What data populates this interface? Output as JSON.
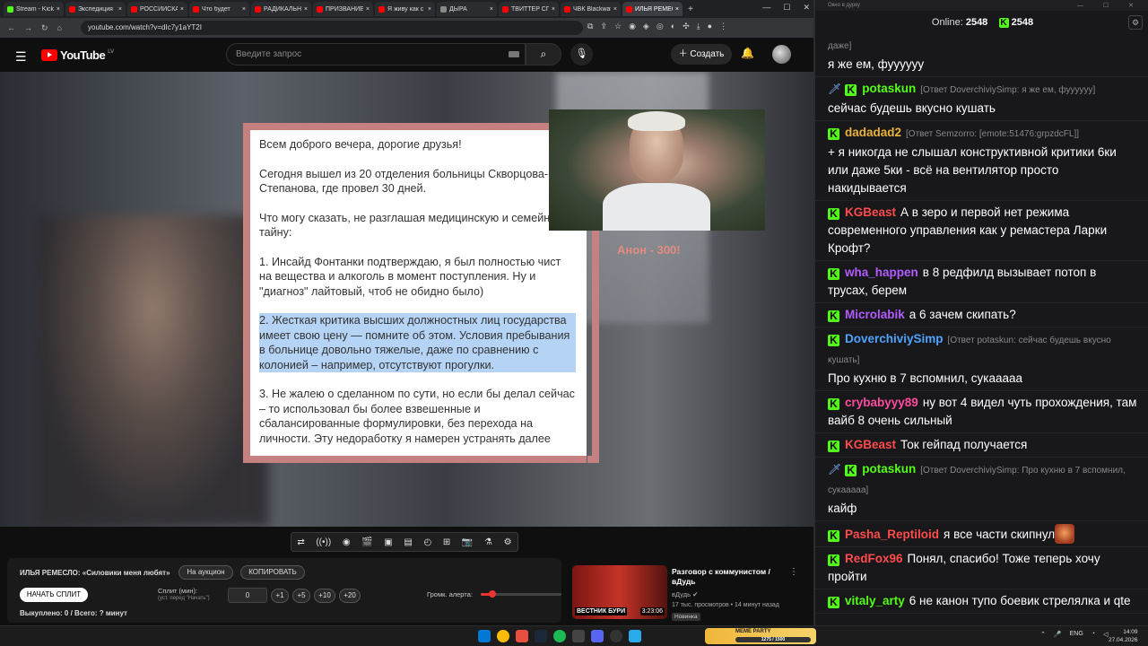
{
  "browser": {
    "tabs": [
      {
        "label": "Stream - Kick",
        "color": "#53fc18"
      },
      {
        "label": "Экспедиция",
        "color": "#ff0000"
      },
      {
        "label": "РОССИЙСКАЯ",
        "color": "#ff0000"
      },
      {
        "label": "Что будет",
        "color": "#ff0000"
      },
      {
        "label": "РАДИКАЛЬНЫЙ",
        "color": "#ff0000"
      },
      {
        "label": "ПРИЗВАНИЕ",
        "color": "#ff0000"
      },
      {
        "label": "Я живу как с",
        "color": "#ff0000"
      },
      {
        "label": "ДЫРА",
        "color": "#888888"
      },
      {
        "label": "ТВИТТЕР СПО",
        "color": "#ff0000"
      },
      {
        "label": "ЧВК Blackwat",
        "color": "#ff0000"
      },
      {
        "label": "ИЛЬЯ РЕМЕСЛО",
        "color": "#ff0000"
      }
    ],
    "new_tab": "+",
    "url": "youtube.com/watch?v=dIc7y1aYT2I"
  },
  "youtube": {
    "logo_text": "YouTube",
    "country": "LV",
    "search_placeholder": "Введите запрос",
    "create_label": "Создать"
  },
  "video": {
    "doc_paragraphs": [
      "Всем доброго вечера, дорогие друзья!",
      "Сегодня вышел из 20 отделения больницы Скворцова-Степанова, где провел 30 дней.",
      "Что могу сказать, не разглашая медицинскую и семейную тайну:",
      "1. Инсайд Фонтанки подтверждаю, я был полностью чист на вещества и алкоголь в момент поступления. Ну и \"диагноз\" лайтовый, чтоб не обидно было)",
      "2. Жесткая критика высших должностных лиц государства имеет свою цену — помните об этом. Условия пребывания в больнице довольно тяжелые, даже по сравнению с колонией – например, отсутствуют прогулки.",
      "3. Не жалею о сделанном по сути, но если бы делал сейчас – то использовал бы более взвешенные и сбалансированные формулировки, без перехода на личности. Эту недоработку я намерен устранять далее"
    ],
    "highlight_index": 4,
    "highlight_color": "#b5d3f5",
    "frame_color": "#c5817f",
    "overlay_text": "Анон - 300!"
  },
  "toolbar_icons": [
    "loop-icon",
    "broadcast-icon",
    "eye-icon",
    "clapperboard-icon",
    "picture-in-picture-icon",
    "film-icon",
    "speedometer-icon",
    "image-add-icon",
    "camera-icon",
    "flask-icon",
    "gear-icon"
  ],
  "auction": {
    "title": "ИЛЬЯ РЕМЕСЛО: «Силовики меня любят»",
    "on_auction": "На аукцион",
    "copy": "КОПИРОВАТЬ",
    "start_split": "НАЧАТЬ СПЛИТ",
    "split_label": "Сплит (мин):",
    "split_sub": "(уст. перед \"Начать\")",
    "split_value": "0",
    "increments": [
      "+1",
      "+5",
      "+10",
      "+20"
    ],
    "volume_label": "Громк. алерта:",
    "volume_level": 0.12,
    "bought": "Выкуплено: 0 / Всего: ? минут"
  },
  "recommendation": {
    "thumb_caption": "ВЕСТНИК БУРИ",
    "duration": "3:23:06",
    "title": "Разговор с коммунистом / вДудь",
    "channel": "вДудь",
    "meta": "17 тыс. просмотров • 14 минут назад",
    "badge": "Новинка"
  },
  "chat": {
    "window_title": "Окно в дурку",
    "online_label": "Online:",
    "online_count": "2548",
    "kick_count": "2548",
    "messages": [
      {
        "nick": "",
        "color": "#ffffff",
        "reply": "даже]",
        "text": "я же ем, фуууууу",
        "badge": false,
        "sword": false
      },
      {
        "nick": "potaskun",
        "color": "#53fc18",
        "reply": "[Ответ DoverchiviySimp: я же ем, фуууууу]",
        "text": "сейчас будешь вкусно кушать",
        "badge": true,
        "sword": true
      },
      {
        "nick": "dadadad2",
        "color": "#e9b23a",
        "reply": "[Ответ Semzorro: [emote:51476:grpzdcFL]]",
        "text": "+ я никогда не слышал конструктивной критики 6ки или даже 5ки - всё на вентилятор просто накидывается",
        "badge": true,
        "sword": false
      },
      {
        "nick": "KGBeast",
        "color": "#ff4b4b",
        "reply": "",
        "text": "А в зеро и первой нет режима современного управления как у ремастера Ларки Крофт?",
        "badge": true,
        "sword": false
      },
      {
        "nick": "wha_happen",
        "color": "#b05cff",
        "reply": "",
        "text": "в 8 редфилд вызывает потоп в трусах, берем",
        "badge": true,
        "sword": false
      },
      {
        "nick": "Microlabik",
        "color": "#b05cff",
        "reply": "",
        "text": "а 6 зачем скипать?",
        "badge": true,
        "sword": false
      },
      {
        "nick": "DoverchiviySimp",
        "color": "#4fa3ff",
        "reply": "[Ответ potaskun: сейчас будешь вкусно кушать]",
        "text": "Про кухню в 7 вспомнил, сукааааа",
        "badge": true,
        "sword": false
      },
      {
        "nick": "crybabyyy89",
        "color": "#ff4b9e",
        "reply": "",
        "text": "ну вот 4 видел чуть прохождения, там вайб 8 очень сильный",
        "badge": true,
        "sword": false
      },
      {
        "nick": "KGBeast",
        "color": "#ff4b4b",
        "reply": "",
        "text": "Ток гейпад получается",
        "badge": true,
        "sword": false
      },
      {
        "nick": "potaskun",
        "color": "#53fc18",
        "reply": "[Ответ DoverchiviySimp: Про кухню в 7 вспомнил, сукааааа]",
        "text": "кайф",
        "badge": true,
        "sword": true
      },
      {
        "nick": "Pasha_Reptiloid",
        "color": "#ff4b4b",
        "reply": "",
        "text": "я все части скипнул",
        "badge": true,
        "sword": false,
        "emote": true
      },
      {
        "nick": "RedFox96",
        "color": "#ff4b4b",
        "reply": "",
        "text": "Понял, спасибо! Тоже теперь хочу пройти",
        "badge": true,
        "sword": false
      },
      {
        "nick": "vitaly_arty",
        "color": "#53fc18",
        "reply": "",
        "text": "6 не канон тупо боевик стрелялка и qte",
        "badge": true,
        "sword": false
      }
    ]
  },
  "taskbar": {
    "meme_label": "MEME PARTY",
    "meme_progress": "1275 / 1500",
    "lang": "ENG",
    "time": "14:09",
    "date": "27.04.2026"
  }
}
